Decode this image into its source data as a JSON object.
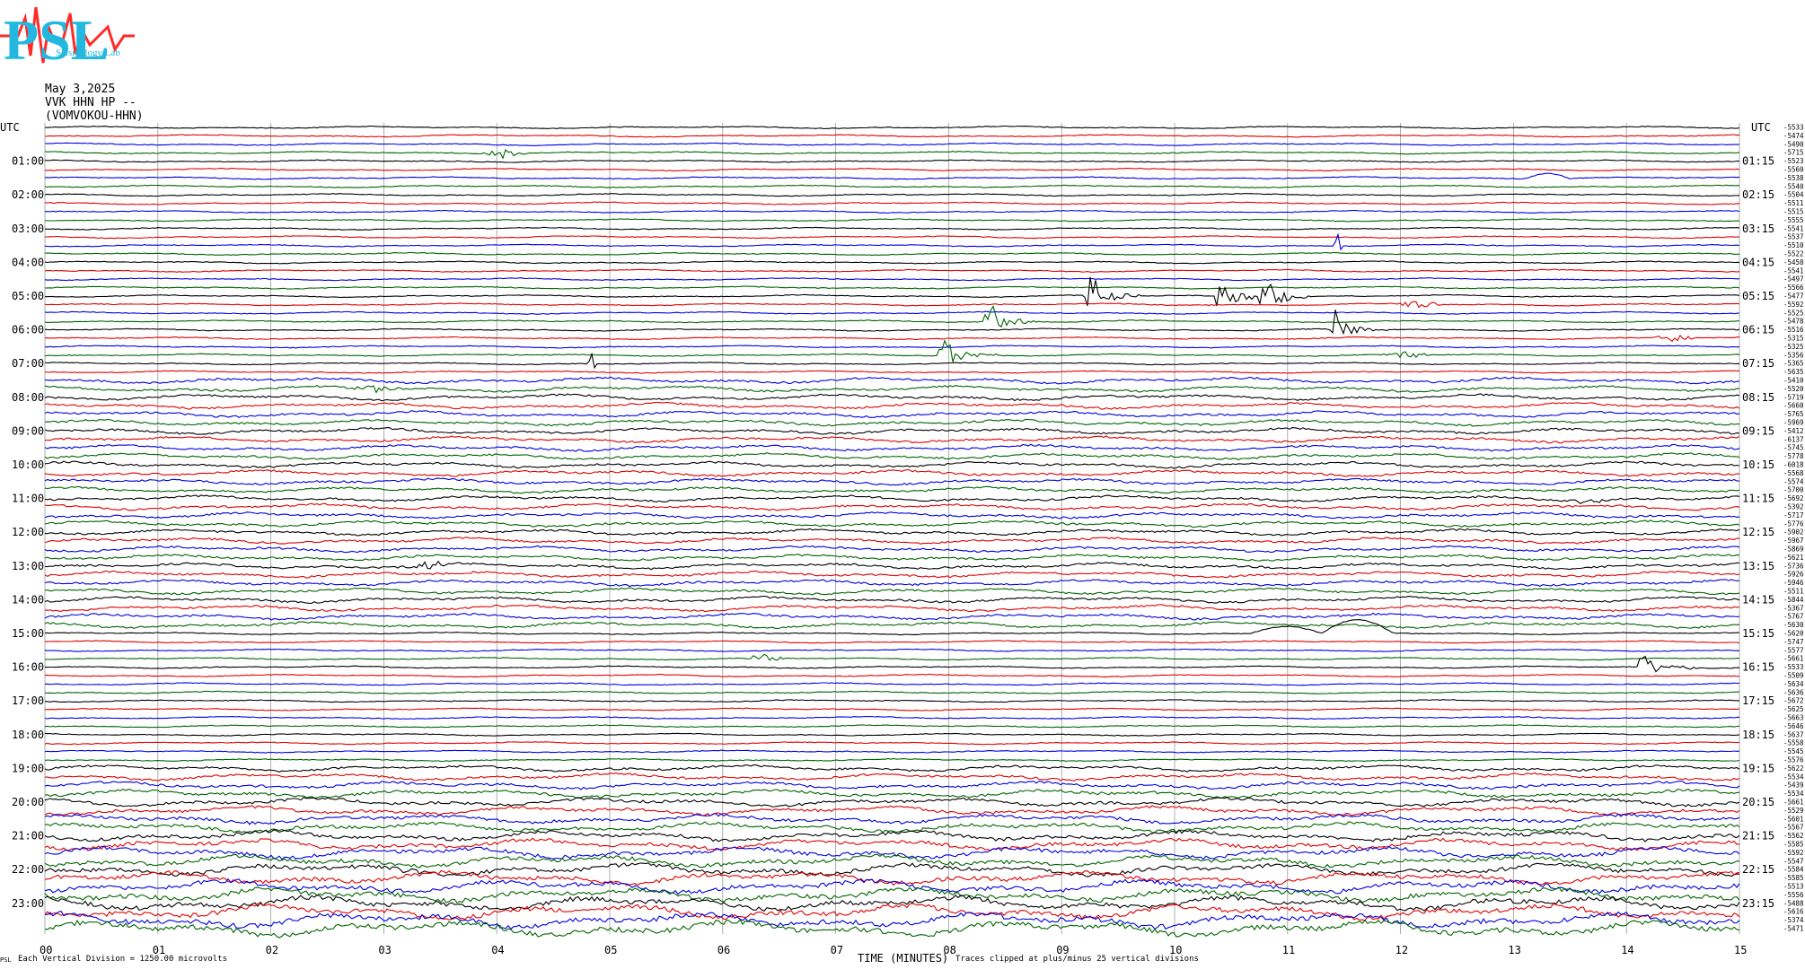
{
  "logo": {
    "text": "PSL",
    "subtitle": "Seismology Lab",
    "colors": {
      "letters": "#23b8e0",
      "trace": "#ff2a2a"
    }
  },
  "header": {
    "date": "May 3,2025",
    "station": "VVK HHN HP --",
    "station_name": "(VOMVOKOU-HHN)"
  },
  "footer": {
    "division": "Each Vertical Division = 1250.00 microvolts",
    "xlabel": "TIME (MINUTES)",
    "clip_note": "Traces clipped at plus/minus 25 vertical divisions",
    "corner": "PSL"
  },
  "chart_data": {
    "type": "line",
    "title": "May 3,2025",
    "xlabel": "TIME (MINUTES)",
    "ylabel": "UTC",
    "xlim": [
      0,
      15
    ],
    "x_ticks": [
      "00",
      "01",
      "02",
      "03",
      "04",
      "05",
      "06",
      "07",
      "08",
      "09",
      "10",
      "11",
      "12",
      "13",
      "14",
      "15"
    ],
    "left_labels": [
      "UTC",
      "01:00",
      "02:00",
      "03:00",
      "04:00",
      "05:00",
      "06:00",
      "07:00",
      "08:00",
      "09:00",
      "10:00",
      "11:00",
      "12:00",
      "13:00",
      "14:00",
      "15:00",
      "16:00",
      "17:00",
      "18:00",
      "19:00",
      "20:00",
      "21:00",
      "22:00",
      "23:00"
    ],
    "right_labels": [
      "UTC",
      "01:15",
      "02:15",
      "03:15",
      "04:15",
      "05:15",
      "06:15",
      "07:15",
      "08:15",
      "09:15",
      "10:15",
      "11:15",
      "12:15",
      "13:15",
      "14:15",
      "15:15",
      "16:15",
      "17:15",
      "18:15",
      "19:15",
      "20:15",
      "21:15",
      "22:15",
      "23:15"
    ],
    "trace_colors": [
      "#000000",
      "#e00000",
      "#0000dd",
      "#006400"
    ],
    "rows_per_hour": 4,
    "row_count": 96,
    "offsets": [
      "-5533",
      "-5474",
      "-5490",
      "-5715",
      "-5523",
      "-5560",
      "-5538",
      "-5540",
      "-5504",
      "-5511",
      "-5515",
      "-5555",
      "-5541",
      "-5537",
      "-5510",
      "-5522",
      "-5458",
      "-5541",
      "-5497",
      "-5566",
      "-5477",
      "-5592",
      "-5525",
      "-5478",
      "-5516",
      "-5315",
      "-5325",
      "-5356",
      "-5365",
      "-5635",
      "-5410",
      "-5520",
      "-5719",
      "-5660",
      "-5765",
      "-5969",
      "-5412",
      "-6137",
      "-5745",
      "-5778",
      "-6018",
      "-5568",
      "-5574",
      "-5700",
      "-5692",
      "-5392",
      "-5717",
      "-5776",
      "-5902",
      "-5967",
      "-5869",
      "-5621",
      "-5736",
      "-5926",
      "-5946",
      "-5511",
      "-5844",
      "-5367",
      "-5767",
      "-5630",
      "-5620",
      "-5747",
      "-5577",
      "-5661",
      "-5533",
      "-5509",
      "-5634",
      "-5636",
      "-5672",
      "-5625",
      "-5663",
      "-5646",
      "-5637",
      "-5558",
      "-5545",
      "-5576",
      "-5622",
      "-5534",
      "-5439",
      "-5534",
      "-5661",
      "-5529",
      "-5601",
      "-5567",
      "-5562",
      "-5585",
      "-5592",
      "-5547",
      "-5584",
      "-5585",
      "-5513",
      "-5556",
      "-5488",
      "-5616",
      "-5374",
      "-5471"
    ],
    "events": [
      {
        "row": 3,
        "minute": 4.05,
        "type": "burst",
        "color": "#000000"
      },
      {
        "row": 6,
        "minute": 13.3,
        "type": "bump",
        "color": "#006400"
      },
      {
        "row": 14,
        "minute": 11.45,
        "type": "spike",
        "color": "#0000dd"
      },
      {
        "row": 20,
        "minute": 9.25,
        "type": "quake",
        "color": "#000000"
      },
      {
        "row": 20,
        "minute": 10.4,
        "type": "quake",
        "color": "#000000"
      },
      {
        "row": 20,
        "minute": 10.8,
        "type": "quake",
        "color": "#000000"
      },
      {
        "row": 21,
        "minute": 12.15,
        "type": "burst",
        "color": "#e00000"
      },
      {
        "row": 23,
        "minute": 8.35,
        "type": "quake",
        "color": "#006400"
      },
      {
        "row": 24,
        "minute": 11.4,
        "type": "quake",
        "color": "#000000"
      },
      {
        "row": 25,
        "minute": 14.4,
        "type": "burst",
        "color": "#e00000"
      },
      {
        "row": 27,
        "minute": 7.95,
        "type": "quake",
        "color": "#006400"
      },
      {
        "row": 27,
        "minute": 12.05,
        "type": "burst",
        "color": "#006400"
      },
      {
        "row": 28,
        "minute": 4.85,
        "type": "spike",
        "color": "#000000"
      },
      {
        "row": 31,
        "minute": 2.95,
        "type": "burst",
        "color": "#006400"
      },
      {
        "row": 44,
        "minute": 13.7,
        "type": "burst",
        "color": "#e00000"
      },
      {
        "row": 52,
        "minute": 3.4,
        "type": "burst",
        "color": "#000000"
      },
      {
        "row": 60,
        "minute": 11.3,
        "type": "wave",
        "color": "#000000"
      },
      {
        "row": 63,
        "minute": 6.35,
        "type": "burst",
        "color": "#006400"
      },
      {
        "row": 64,
        "minute": 14.15,
        "type": "quake",
        "color": "#000000"
      },
      {
        "row": 88,
        "minute": 3.15,
        "type": "burst",
        "color": "#000000"
      }
    ]
  }
}
